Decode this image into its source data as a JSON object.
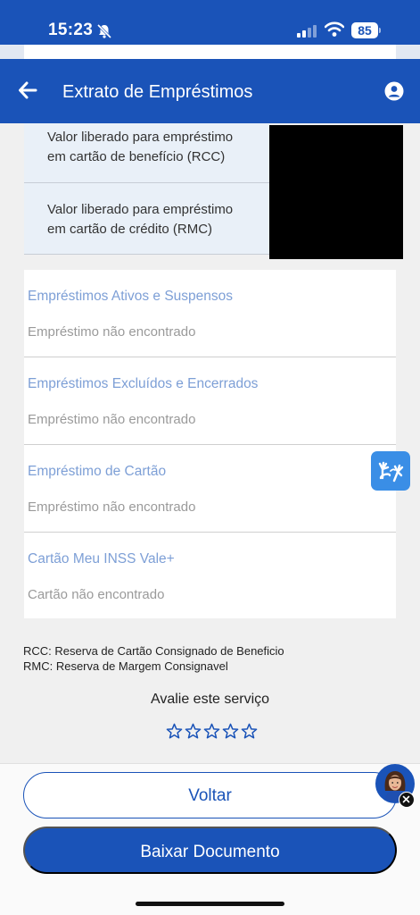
{
  "status_bar": {
    "time": "15:23",
    "battery": "85"
  },
  "header": {
    "title": "Extrato de Empréstimos"
  },
  "values": [
    {
      "line1": "Valor liberado para empréstimo",
      "line2": "em cartão de benefício (RCC)"
    },
    {
      "line1": "Valor liberado para empréstimo",
      "line2": "em cartão de crédito (RMC)"
    }
  ],
  "sections": [
    {
      "title": "Empréstimos Ativos e Suspensos",
      "status": "Empréstimo não encontrado"
    },
    {
      "title": "Empréstimos Excluídos e Encerrados",
      "status": "Empréstimo não encontrado"
    },
    {
      "title": "Empréstimo de Cartão",
      "status": "Empréstimo não encontrado"
    },
    {
      "title": "Cartão Meu INSS Vale+",
      "status": "Cartão não encontrado"
    }
  ],
  "legend": {
    "rcc": "RCC: Reserva de Cartão Consignado de Beneficio",
    "rmc": "RMC: Reserva de Margem Consignavel"
  },
  "rating": {
    "label": "Avalie este serviço",
    "stars_total": 5,
    "stars_selected": 0
  },
  "buttons": {
    "voltar": "Voltar",
    "baixar": "Baixar Documento"
  },
  "colors": {
    "primary": "#1a53b8",
    "section_title": "#7d9fd6",
    "libras": "#3a8ee6"
  },
  "icons": {
    "status": [
      "bell-off-icon",
      "signal-icon",
      "wifi-icon",
      "battery-icon"
    ],
    "header": [
      "back-arrow-icon",
      "user-icon"
    ],
    "floating": [
      "libras-hands-icon",
      "assistant-avatar-icon",
      "close-icon"
    ],
    "rating": "star-outline-icon"
  }
}
